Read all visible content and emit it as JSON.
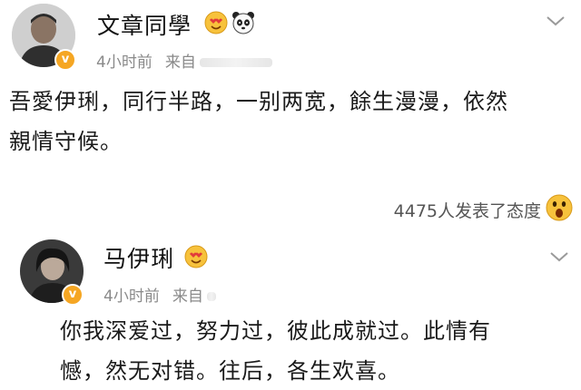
{
  "post1": {
    "username": "文章同學",
    "time": "4小时前",
    "source_prefix": "来自",
    "content_line1": "吾愛伊琍，同行半路，一别两宽，餘生漫漫，依然",
    "content_line2": "親情守候。",
    "reaction_count": "4475人发表了态度"
  },
  "post2": {
    "username": "马伊琍",
    "time": "4小时前",
    "source_prefix": "来自",
    "content_line1": "你我深爱过，努力过，彼此成就过。此情有",
    "content_line2": "憾，然无对错。往后，各生欢喜。"
  },
  "colors": {
    "verified_badge": "#f5a623",
    "meta_text": "#8a8a8a",
    "content_text": "#1a1a1a"
  },
  "icons": {
    "verified": "verified-badge-icon",
    "heart_face": "heart-eyes-emoji-icon",
    "panda": "panda-emoji-icon",
    "surprised": "surprised-emoji-icon",
    "chevron": "chevron-down-icon"
  }
}
